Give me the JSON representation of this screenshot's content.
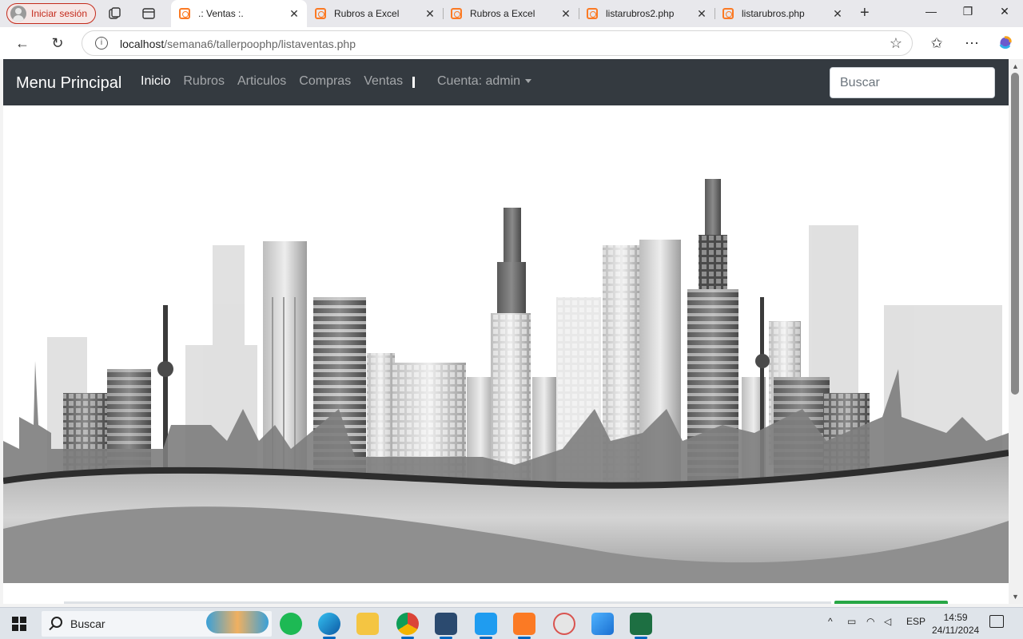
{
  "browser": {
    "profile_label": "Iniciar sesión",
    "tabs": [
      {
        "title": ".: Ventas :.",
        "active": true
      },
      {
        "title": "Rubros a Excel",
        "active": false
      },
      {
        "title": "Rubros a Excel",
        "active": false
      },
      {
        "title": "listarubros2.php",
        "active": false
      },
      {
        "title": "listarubros.php",
        "active": false
      }
    ],
    "url_host": "localhost",
    "url_path": "/semana6/tallerpoophp/listaventas.php"
  },
  "page": {
    "brand": "Menu Principal",
    "nav": [
      "Inicio",
      "Rubros",
      "Articulos",
      "Compras",
      "Ventas"
    ],
    "account_label": "Cuenta: admin",
    "search_placeholder": "Buscar"
  },
  "taskbar": {
    "search_label": "Buscar",
    "language": "ESP",
    "time": "14:59",
    "date": "24/11/2024",
    "apps": [
      "weather-widget",
      "spotify-icon",
      "edge-icon",
      "file-explorer-icon",
      "chrome-icon",
      "database-icon",
      "vscode-icon",
      "xampp-icon",
      "paint-icon",
      "photos-icon",
      "excel-icon"
    ]
  },
  "colors": {
    "navbar": "#343a40",
    "accent_tab": "#fb7a24",
    "profile_red": "#c42b1c"
  }
}
